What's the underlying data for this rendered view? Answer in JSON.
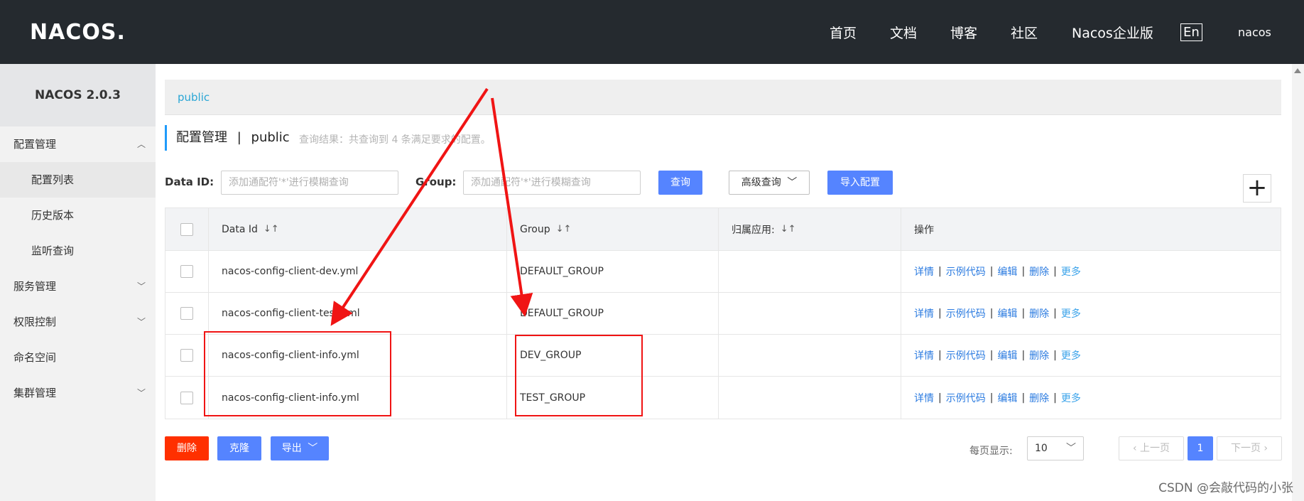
{
  "header": {
    "logo": "NACOS.",
    "nav": [
      "首页",
      "文档",
      "博客",
      "社区",
      "Nacos企业版"
    ],
    "lang": "En",
    "user": "nacos"
  },
  "sidebar": {
    "title": "NACOS 2.0.3",
    "items": [
      {
        "label": "配置管理",
        "expanded": true
      },
      {
        "label": "配置列表",
        "active": true
      },
      {
        "label": "历史版本"
      },
      {
        "label": "监听查询"
      },
      {
        "label": "服务管理"
      },
      {
        "label": "权限控制"
      },
      {
        "label": "命名空间"
      },
      {
        "label": "集群管理"
      }
    ]
  },
  "main": {
    "namespace": "public",
    "title_main": "配置管理",
    "title_sep": "|",
    "title_ns": "public",
    "result": "查询结果：共查询到 4 条满足要求的配置。",
    "search": {
      "data_id_label": "Data ID:",
      "data_id_placeholder": "添加通配符'*'进行模糊查询",
      "group_label": "Group:",
      "group_placeholder": "添加通配符'*'进行模糊查询",
      "query_btn": "查询",
      "advanced_btn": "高级查询",
      "import_btn": "导入配置"
    },
    "table": {
      "headers": [
        "Data Id",
        "Group",
        "归属应用:",
        "操作"
      ],
      "rows": [
        {
          "data_id": "nacos-config-client-dev.yml",
          "group": "DEFAULT_GROUP",
          "app": ""
        },
        {
          "data_id": "nacos-config-client-test.yml",
          "group": "DEFAULT_GROUP",
          "app": ""
        },
        {
          "data_id": "nacos-config-client-info.yml",
          "group": "DEV_GROUP",
          "app": ""
        },
        {
          "data_id": "nacos-config-client-info.yml",
          "group": "TEST_GROUP",
          "app": ""
        }
      ],
      "ops": {
        "detail": "详情",
        "sample": "示例代码",
        "edit": "编辑",
        "delete": "删除",
        "more": "更多",
        "sep": "|"
      }
    },
    "footer": {
      "delete_btn": "删除",
      "clone_btn": "克隆",
      "export_btn": "导出",
      "page_size_label": "每页显示:",
      "page_size": "10",
      "prev": "上一页",
      "current_page": "1",
      "next": "下一页"
    }
  },
  "watermark": "CSDN @会敲代码的小张",
  "colors": {
    "header_bg": "#252a2f",
    "primary": "#5584ff",
    "danger": "#ff3000",
    "annotation": "#f01414",
    "link": "#2b7be0"
  }
}
